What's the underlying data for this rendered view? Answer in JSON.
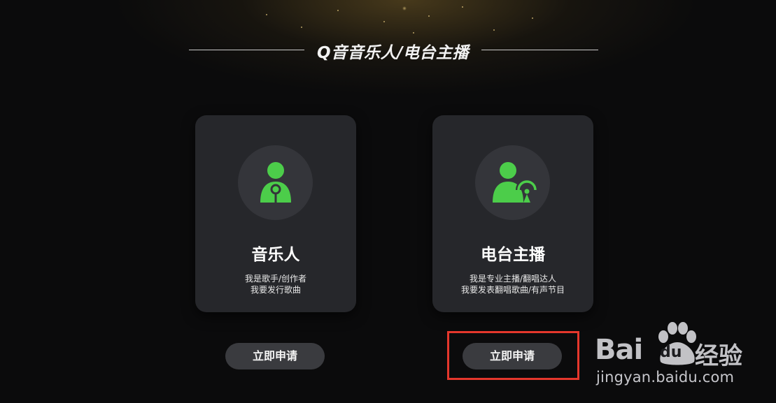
{
  "header": {
    "title": "Q音音乐人/电台主播"
  },
  "cards": [
    {
      "icon": "musician-icon",
      "title": "音乐人",
      "desc_line1": "我是歌手/创作者",
      "desc_line2": "我要发行歌曲",
      "button_label": "立即申请"
    },
    {
      "icon": "radio-host-icon",
      "title": "电台主播",
      "desc_line1": "我是专业主播/翻唱达人",
      "desc_line2": "我要发表翻唱歌曲/有声节目",
      "button_label": "立即申请"
    }
  ],
  "colors": {
    "accent_green": "#4ccd4a",
    "highlight_red": "#e5372c",
    "card_bg": "#26272b",
    "button_bg": "#3a3b3f"
  },
  "watermark": {
    "brand_prefix": "Bai",
    "brand_paw_text": "du",
    "brand_suffix": "经验",
    "url": "jingyan.baidu.com"
  }
}
